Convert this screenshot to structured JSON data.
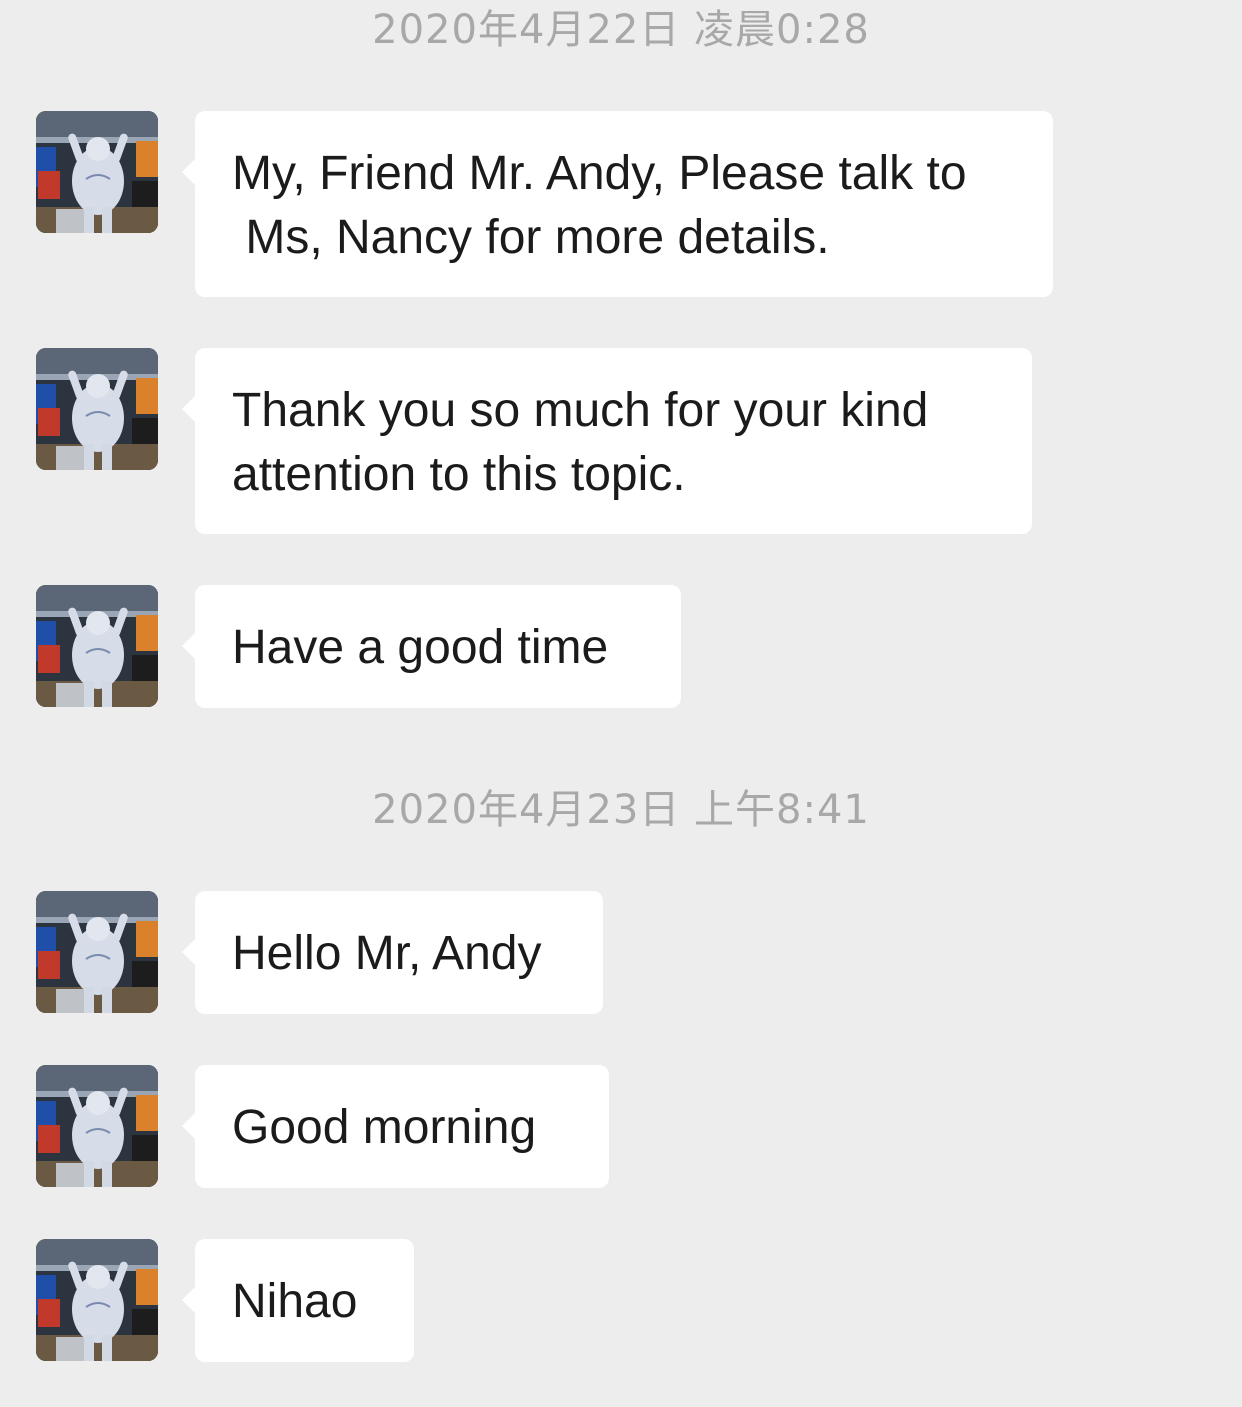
{
  "timestamps": [
    "2020年4月22日 凌晨0:28",
    "2020年4月23日 上午8:41"
  ],
  "messages": [
    {
      "text": "My, Friend Mr. Andy, Please talk to\n Ms, Nancy for more details."
    },
    {
      "text": "Thank you so much for your kind\nattention to this topic."
    },
    {
      "text": "Have a good time"
    },
    {
      "text": "Hello Mr, Andy"
    },
    {
      "text": "Good morning"
    },
    {
      "text": "Nihao"
    }
  ],
  "colors": {
    "background": "#ededed",
    "bubble": "#ffffff",
    "timestamp_text": "#a8a8a8",
    "message_text": "#1b1b1b"
  }
}
